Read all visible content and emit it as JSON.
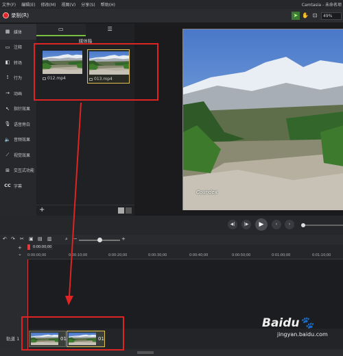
{
  "menu": {
    "items": [
      "文件(F)",
      "编辑(E)",
      "修改(M)",
      "视图(V)",
      "分享(S)",
      "帮助(H)"
    ],
    "app_title": "Camtasia - 未命名项"
  },
  "toolbar": {
    "record_label": "录制(R)",
    "zoom": "49%"
  },
  "sidebar": {
    "items": [
      {
        "label": "媒体",
        "icon": "film-icon"
      },
      {
        "label": "注释",
        "icon": "annotation-icon"
      },
      {
        "label": "转场",
        "icon": "transition-icon"
      },
      {
        "label": "行为",
        "icon": "behavior-icon"
      },
      {
        "label": "动画",
        "icon": "animation-icon"
      },
      {
        "label": "指针效果",
        "icon": "cursor-effect-icon"
      },
      {
        "label": "语音旁白",
        "icon": "microphone-icon"
      },
      {
        "label": "音频效果",
        "icon": "speaker-icon"
      },
      {
        "label": "视觉效果",
        "icon": "wand-icon"
      },
      {
        "label": "交互式功能",
        "icon": "interactive-icon"
      },
      {
        "label": "字幕",
        "icon": "cc-icon"
      }
    ]
  },
  "media_bin": {
    "title": "媒体箱",
    "clips": [
      {
        "name": "012.mp4"
      },
      {
        "name": "013.mp4"
      }
    ]
  },
  "video": {
    "watermark": "Coundex"
  },
  "timeline": {
    "playhead_time": "0:00:00;00",
    "ticks": [
      "0:00:00;00",
      "0:00:10;00",
      "0:00:20;00",
      "0:00:30;00",
      "0:00:40;00",
      "0:00:50;00",
      "0:01:00;00",
      "0:01:10;00"
    ],
    "track_label": "轨道 1",
    "clips": [
      {
        "label": "01"
      },
      {
        "label": "01"
      }
    ]
  },
  "page_watermark": {
    "brand": "Baidu",
    "sub": "jingyan.baidu.com"
  },
  "colors": {
    "accent": "#7ac143",
    "selection": "#e0c350",
    "annotation": "#e02424",
    "record": "#e0262d"
  }
}
